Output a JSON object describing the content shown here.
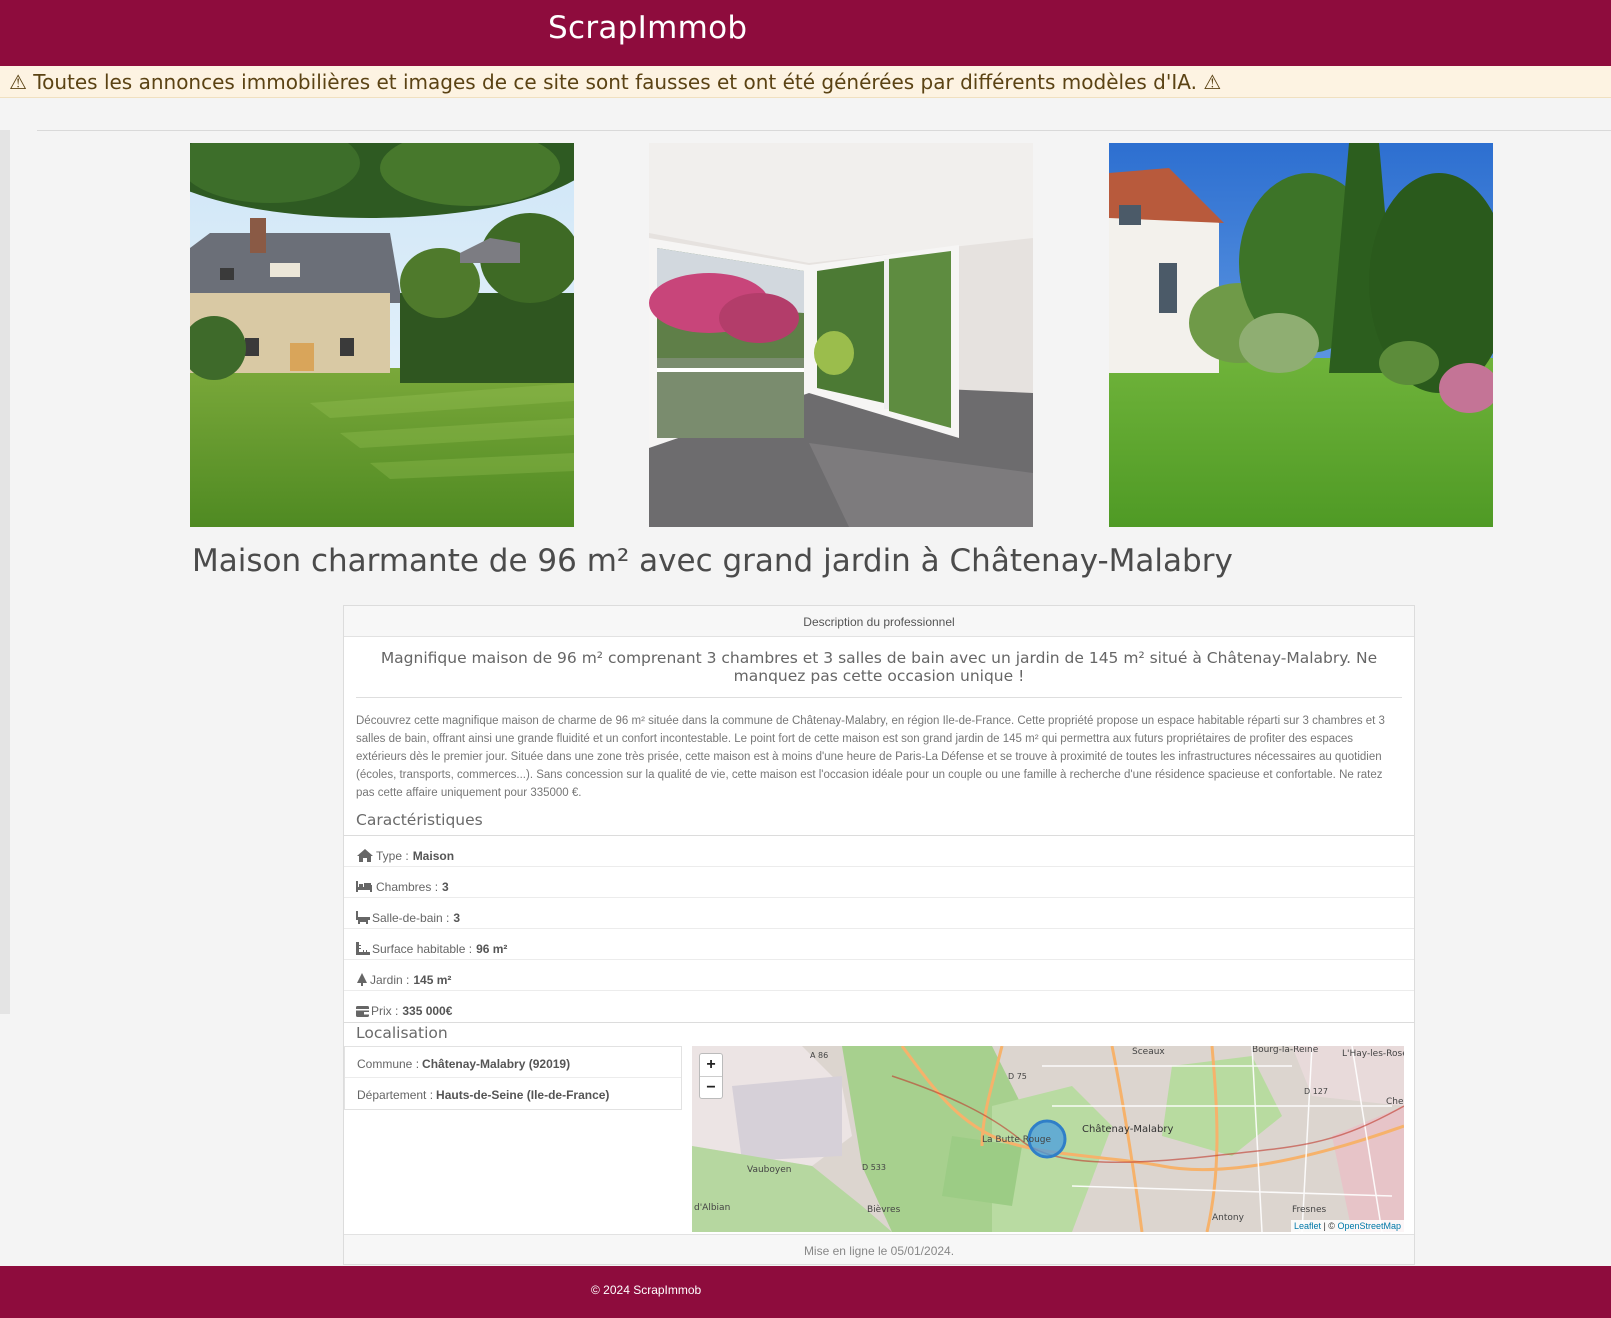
{
  "header": {
    "brand": "ScrapImmob"
  },
  "warning": {
    "text": "⚠ Toutes les annonces immobilières et images de ce site sont fausses et ont été générées par différents modèles d'IA. ⚠"
  },
  "listing": {
    "title": "Maison charmante de 96 m² avec grand jardin à Châtenay-Malabry",
    "panel_heading": "Description du professionnel",
    "lead": "Magnifique maison de 96 m² comprenant 3 chambres et 3 salles de bain avec un jardin de 145 m² situé à Châtenay-Malabry. Ne manquez pas cette occasion unique !",
    "description": "Découvrez cette magnifique maison de charme de 96 m² située dans la commune de Châtenay-Malabry, en région Ile-de-France. Cette propriété propose un espace habitable réparti sur 3 chambres et 3 salles de bain, offrant ainsi une grande fluidité et un confort incontestable. Le point fort de cette maison est son grand jardin de 145 m² qui permettra aux futurs propriétaires de profiter des espaces extérieurs dès le premier jour. Située dans une zone très prisée, cette maison est à moins d'une heure de Paris-La Défense et se trouve à proximité de toutes les infrastructures nécessaires au quotidien (écoles, transports, commerces...). Sans concession sur la qualité de vie, cette maison est l'occasion idéale pour un couple ou une famille à recherche d'une résidence spacieuse et confortable. Ne ratez pas cette affaire uniquement pour 335000 €.",
    "features_title": "Caractéristiques",
    "features": [
      {
        "icon": "house-icon",
        "label": "Type :",
        "value": "Maison"
      },
      {
        "icon": "bed-icon",
        "label": "Chambres :",
        "value": "3"
      },
      {
        "icon": "bath-icon",
        "label": "Salle-de-bain :",
        "value": "3"
      },
      {
        "icon": "ruler-icon",
        "label": "Surface habitable :",
        "value": "96 m²"
      },
      {
        "icon": "tree-icon",
        "label": "Jardin :",
        "value": "145 m²"
      },
      {
        "icon": "wallet-icon",
        "label": "Prix :",
        "value": "335 000€"
      }
    ],
    "location_title": "Localisation",
    "location": [
      {
        "label": "Commune :",
        "value": "Châtenay-Malabry (92019)"
      },
      {
        "label": "Département :",
        "value": "Hauts-de-Seine (Ile-de-France)"
      }
    ],
    "map": {
      "zoom_in": "+",
      "zoom_out": "−",
      "attribution_leaflet": "Leaflet",
      "attribution_sep": " | © ",
      "attribution_osm": "OpenStreetMap",
      "labels": [
        "Sceaux",
        "Bourg-la-Reine",
        "L'Hay-les-Rose",
        "Châtenay-Malabry",
        "La Butte Rouge",
        "Vauboyen",
        "Bièvres",
        "Antony",
        "Fresnes",
        "d'Albian",
        "A 86",
        "D 75",
        "D 127",
        "D 533",
        "Che"
      ]
    },
    "published": "Mise en ligne le 05/01/2024."
  },
  "footer": {
    "text": "© 2024 ScrapImmob"
  },
  "colors": {
    "brand": "#8e0c3d",
    "warning_bg": "#fdf3e2",
    "warning_text": "#5b4314"
  }
}
